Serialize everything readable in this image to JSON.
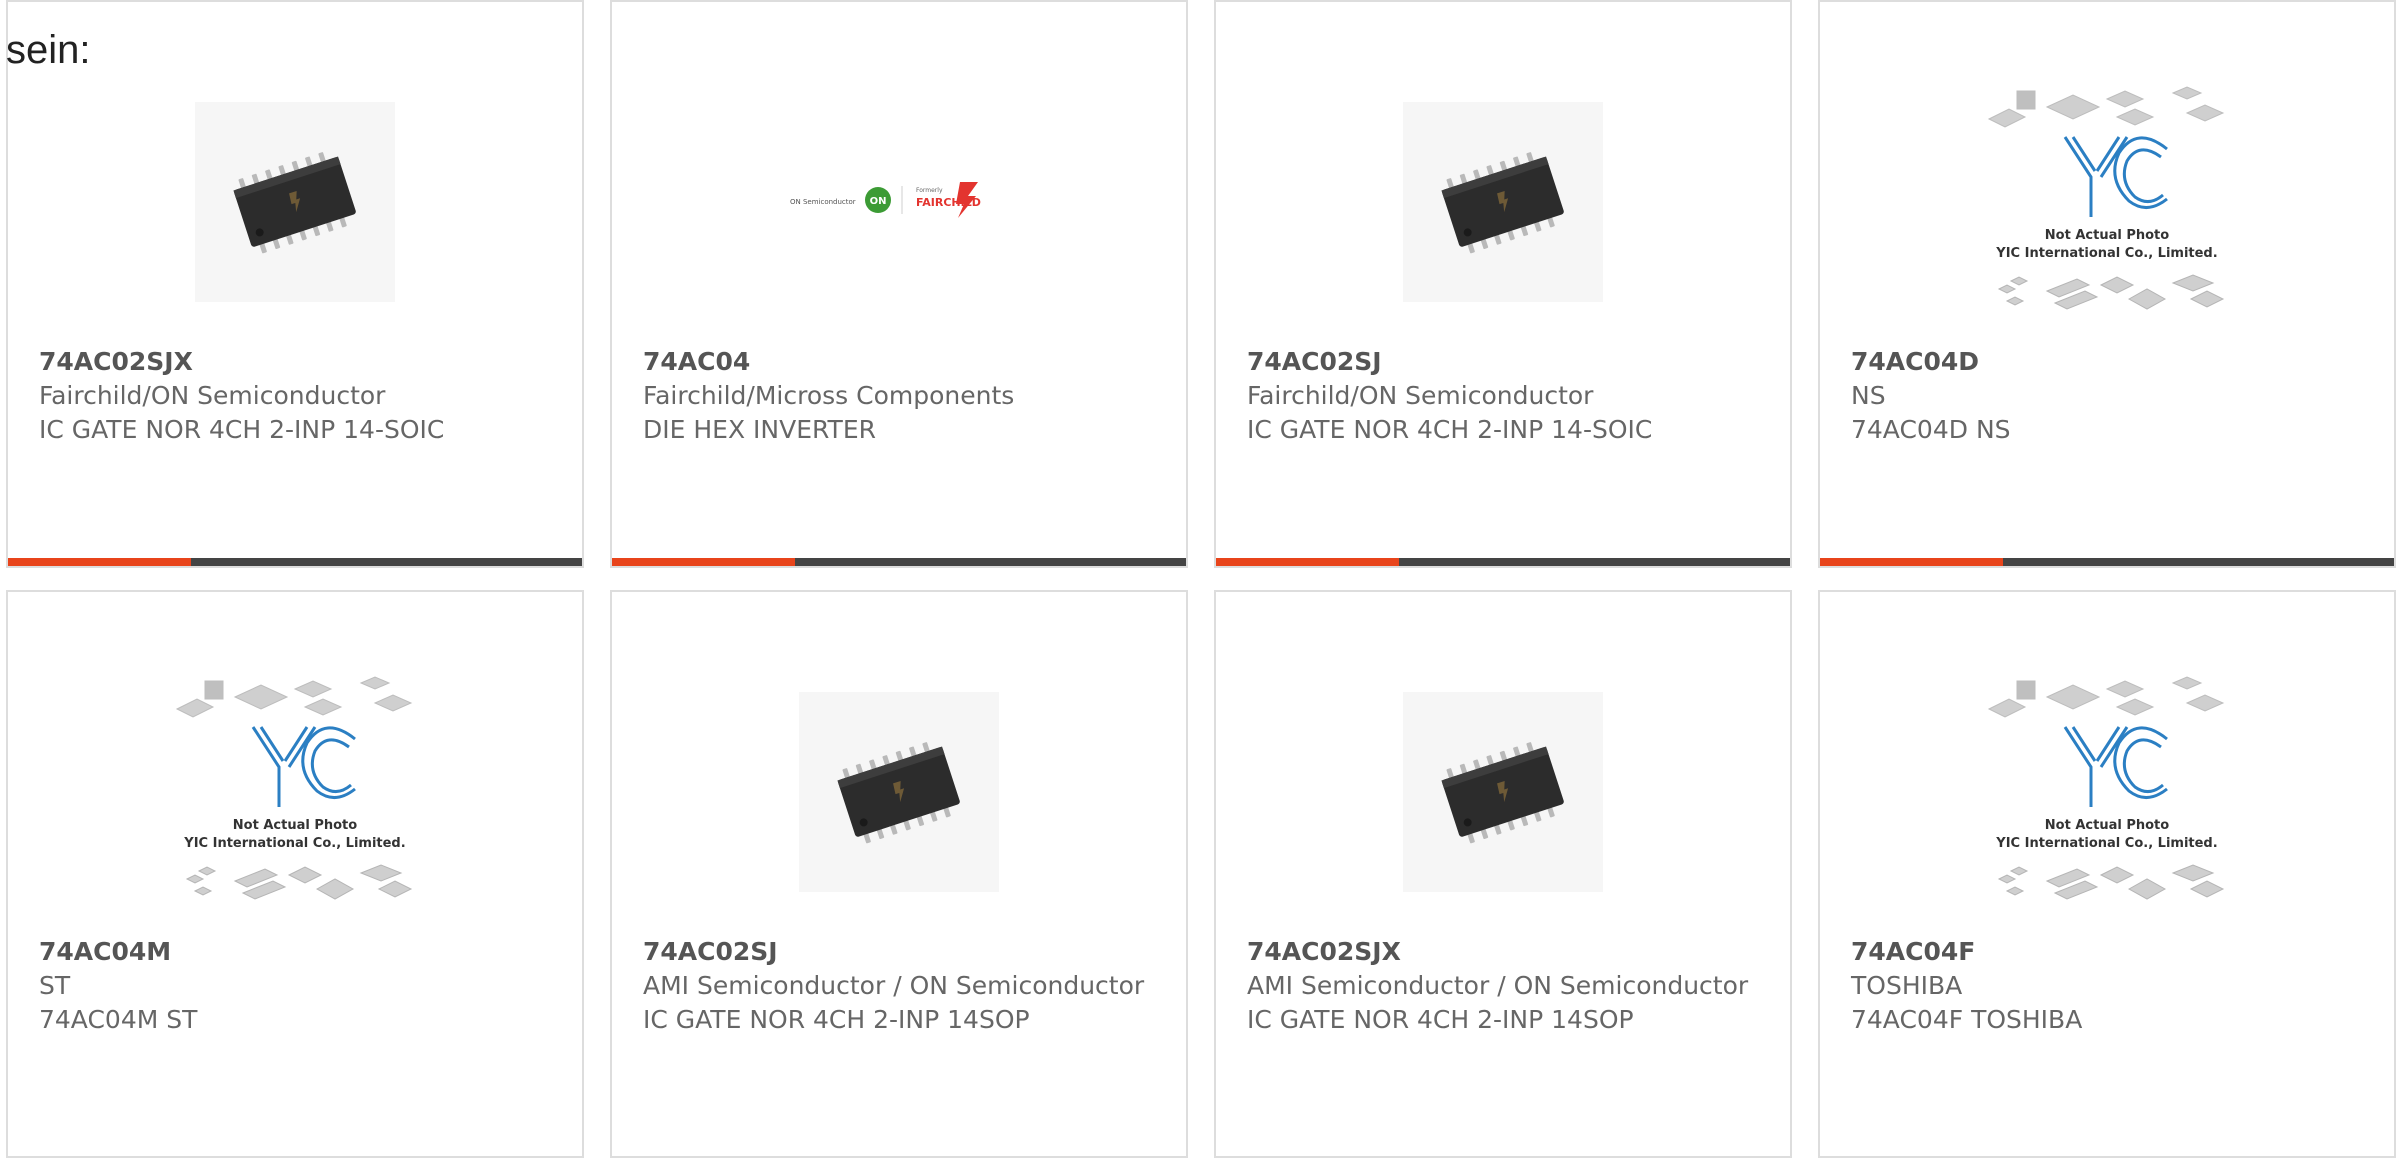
{
  "heading": "sein:",
  "accent_color": "#e8441b",
  "bar_color": "#444444",
  "products": [
    {
      "part": "74AC02SJX",
      "manufacturer": "Fairchild/ON Semiconductor",
      "description": "IC GATE NOR 4CH 2-INP 14-SOIC",
      "image": "chip-photo"
    },
    {
      "part": "74AC04",
      "manufacturer": "Fairchild/Micross Components",
      "description": "DIE HEX INVERTER",
      "image": "brand-logo",
      "logo": {
        "left": "ON Semiconductor",
        "mark": "ON",
        "formerly": "Formerly",
        "right": "FAIRCHILD"
      }
    },
    {
      "part": "74AC02SJ",
      "manufacturer": "Fairchild/ON Semiconductor",
      "description": "IC GATE NOR 4CH 2-INP 14-SOIC",
      "image": "chip-photo"
    },
    {
      "part": "74AC04D",
      "manufacturer": "NS",
      "description": "74AC04D NS",
      "image": "yic-placeholder"
    },
    {
      "part": "74AC04M",
      "manufacturer": "ST",
      "description": "74AC04M ST",
      "image": "yic-placeholder"
    },
    {
      "part": "74AC02SJ",
      "manufacturer": "AMI Semiconductor / ON Semiconductor",
      "description": "IC GATE NOR 4CH 2-INP 14SOP",
      "image": "chip-photo"
    },
    {
      "part": "74AC02SJX",
      "manufacturer": "AMI Semiconductor / ON Semiconductor",
      "description": "IC GATE NOR 4CH 2-INP 14SOP",
      "image": "chip-photo"
    },
    {
      "part": "74AC04F",
      "manufacturer": "TOSHIBA",
      "description": "74AC04F TOSHIBA",
      "image": "yic-placeholder"
    }
  ],
  "placeholder": {
    "logo": "YIC",
    "line1": "Not Actual Photo",
    "line2": "YIC International Co., Limited."
  }
}
